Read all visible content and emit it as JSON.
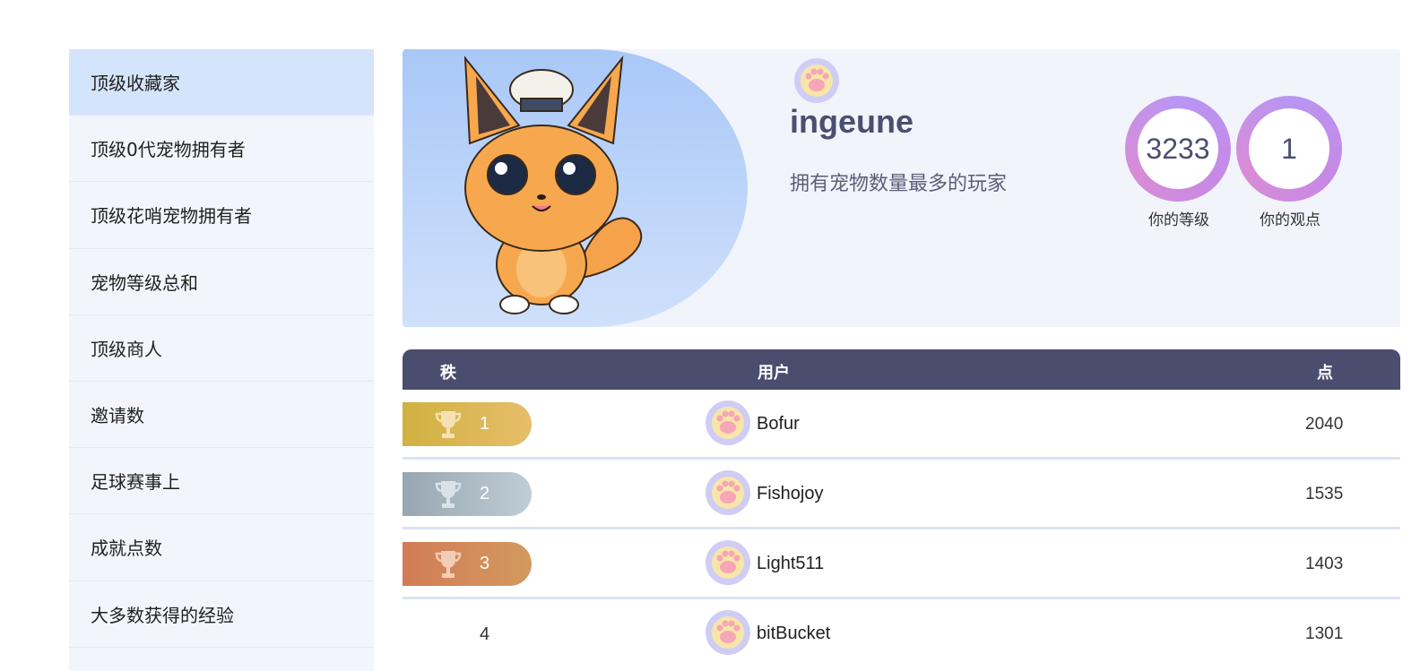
{
  "sidebar": {
    "items": [
      {
        "label": "顶级收藏家",
        "active": true
      },
      {
        "label": "顶级0代宠物拥有者"
      },
      {
        "label": "顶级花哨宠物拥有者"
      },
      {
        "label": "宠物等级总和"
      },
      {
        "label": "顶级商人"
      },
      {
        "label": "邀请数"
      },
      {
        "label": "足球赛事上"
      },
      {
        "label": "成就点数"
      },
      {
        "label": "大多数获得的经验"
      }
    ]
  },
  "hero": {
    "username": "ingeune",
    "description": "拥有宠物数量最多的玩家",
    "stats": [
      {
        "value": "3233",
        "label": "你的等级"
      },
      {
        "value": "1",
        "label": "你的观点"
      }
    ]
  },
  "table": {
    "headers": {
      "rank": "秩",
      "user": "用户",
      "points": "点"
    },
    "rows": [
      {
        "rank": "1",
        "user": "Bofur",
        "points": "2040",
        "medal": "gold"
      },
      {
        "rank": "2",
        "user": "Fishojoy",
        "points": "1535",
        "medal": "silver"
      },
      {
        "rank": "3",
        "user": "Light511",
        "points": "1403",
        "medal": "bronze"
      },
      {
        "rank": "4",
        "user": "bitBucket",
        "points": "1301",
        "medal": "none"
      }
    ]
  },
  "icons": {
    "avatar": "paw-avatar-icon",
    "trophy": "trophy-icon",
    "pet": "fox-chef-pet-illustration"
  },
  "colors": {
    "header_bg": "#4a4d6d",
    "active_item": "#d4e4fb",
    "gold": "#d0b140",
    "silver": "#97a6b0",
    "bronze": "#d27b56"
  }
}
